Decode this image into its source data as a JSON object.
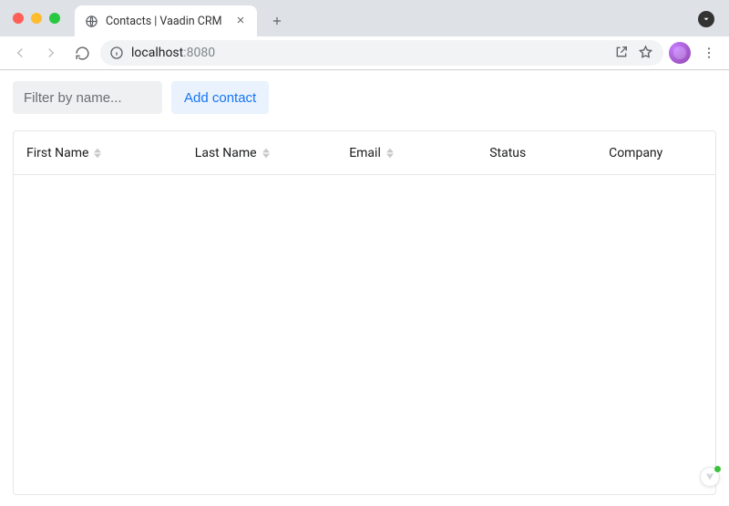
{
  "browser": {
    "tab_title": "Contacts | Vaadin CRM",
    "url_host": "localhost",
    "url_port": ":8080"
  },
  "toolbar": {
    "filter_placeholder": "Filter by name...",
    "add_label": "Add contact"
  },
  "grid": {
    "columns": [
      {
        "label": "First Name",
        "sortable": true
      },
      {
        "label": "Last Name",
        "sortable": true
      },
      {
        "label": "Email",
        "sortable": true
      },
      {
        "label": "Status",
        "sortable": false
      },
      {
        "label": "Company",
        "sortable": false
      }
    ],
    "rows": []
  }
}
